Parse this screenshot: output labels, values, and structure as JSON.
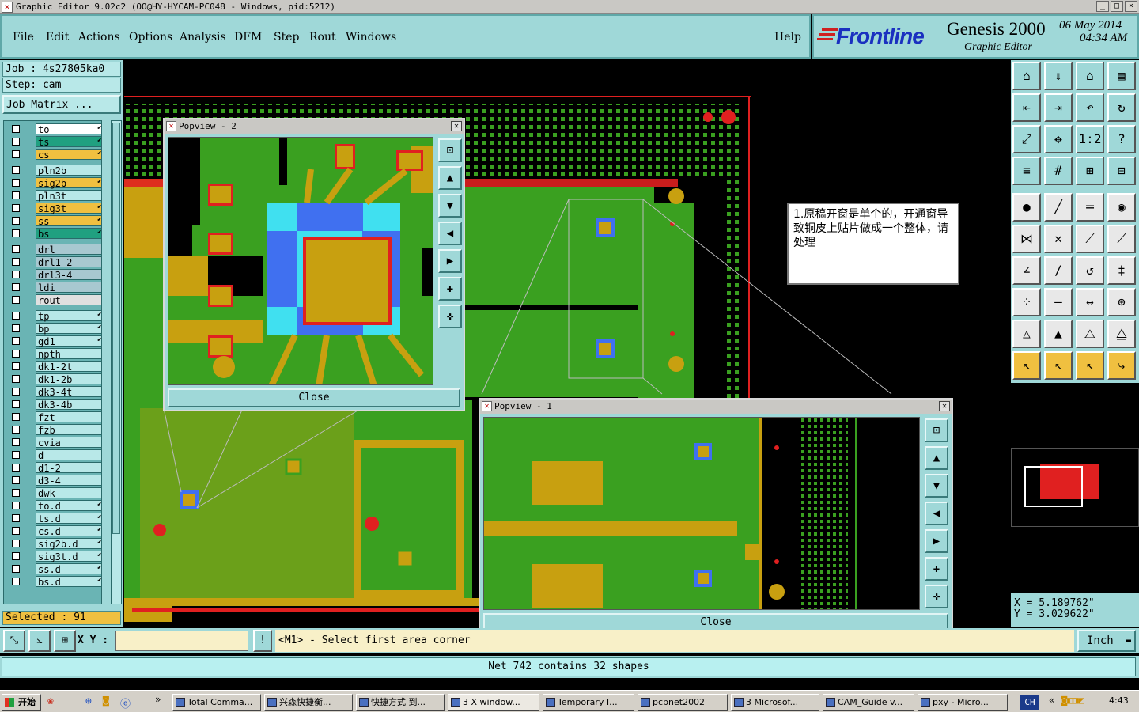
{
  "window": {
    "title": "Graphic Editor 9.02c2 (OO@HY-HYCAM-PC048 - Windows, pid:5212)",
    "controls": [
      "_",
      "□",
      "×"
    ]
  },
  "menu": [
    "File",
    "Edit",
    "Actions",
    "Options",
    "Analysis",
    "DFM",
    "Step",
    "Rout",
    "Windows"
  ],
  "help_label": "Help",
  "brand": {
    "logo": "Frontline",
    "product": "Genesis 2000",
    "subtitle": "Graphic Editor",
    "date": "06 May 2014",
    "time": "04:34 AM"
  },
  "job": {
    "job_label": "Job : 4s27805ka0",
    "step_label": "Step: cam",
    "matrix_button": "Job Matrix ..."
  },
  "layers": [
    {
      "name": "to",
      "color": "#ffffff",
      "mark": "⬋"
    },
    {
      "name": "ts",
      "color": "#20a080",
      "mark": "⬋"
    },
    {
      "name": "cs",
      "color": "#f0c040",
      "mark": "⬋"
    },
    {
      "name": "pln2b",
      "color": "#b8e8e8",
      "mark": ""
    },
    {
      "name": "sig2b",
      "color": "#f0c040",
      "mark": "⬋"
    },
    {
      "name": "pln3t",
      "color": "#b8e8e8",
      "mark": ""
    },
    {
      "name": "sig3t",
      "color": "#f0c040",
      "mark": "⬋"
    },
    {
      "name": "ss",
      "color": "#f0c040",
      "mark": "⬋"
    },
    {
      "name": "bs",
      "color": "#20a080",
      "mark": "⬋"
    },
    {
      "name": "drl",
      "color": "#a8c8d0",
      "mark": ""
    },
    {
      "name": "drl1-2",
      "color": "#a8c8d0",
      "mark": ""
    },
    {
      "name": "drl3-4",
      "color": "#a8c8d0",
      "mark": ""
    },
    {
      "name": "ldi",
      "color": "#a8c8d0",
      "mark": ""
    },
    {
      "name": "rout",
      "color": "#e0e0e0",
      "mark": ""
    },
    {
      "name": "tp",
      "color": "#b8e8e8",
      "mark": "⬋"
    },
    {
      "name": "bp",
      "color": "#b8e8e8",
      "mark": "⬋"
    },
    {
      "name": "gd1",
      "color": "#b8e8e8",
      "mark": "⬋"
    },
    {
      "name": "npth",
      "color": "#b8e8e8",
      "mark": ""
    },
    {
      "name": "dk1-2t",
      "color": "#b8e8e8",
      "mark": ""
    },
    {
      "name": "dk1-2b",
      "color": "#b8e8e8",
      "mark": ""
    },
    {
      "name": "dk3-4t",
      "color": "#b8e8e8",
      "mark": ""
    },
    {
      "name": "dk3-4b",
      "color": "#b8e8e8",
      "mark": ""
    },
    {
      "name": "fzt",
      "color": "#b8e8e8",
      "mark": ""
    },
    {
      "name": "fzb",
      "color": "#b8e8e8",
      "mark": ""
    },
    {
      "name": "cvia",
      "color": "#b8e8e8",
      "mark": ""
    },
    {
      "name": "d",
      "color": "#b8e8e8",
      "mark": ""
    },
    {
      "name": "d1-2",
      "color": "#b8e8e8",
      "mark": ""
    },
    {
      "name": "d3-4",
      "color": "#b8e8e8",
      "mark": ""
    },
    {
      "name": "dwk",
      "color": "#b8e8e8",
      "mark": ""
    },
    {
      "name": "to.d",
      "color": "#b8e8e8",
      "mark": "⬋"
    },
    {
      "name": "ts.d",
      "color": "#b8e8e8",
      "mark": "⬋"
    },
    {
      "name": "cs.d",
      "color": "#b8e8e8",
      "mark": "⬋"
    },
    {
      "name": "sig2b.d",
      "color": "#b8e8e8",
      "mark": "⬋"
    },
    {
      "name": "sig3t.d",
      "color": "#b8e8e8",
      "mark": "⬋"
    },
    {
      "name": "ss.d",
      "color": "#b8e8e8",
      "mark": "⬋"
    },
    {
      "name": "bs.d",
      "color": "#b8e8e8",
      "mark": "⬋"
    }
  ],
  "selected_label": "Selected : 91",
  "popup2": {
    "title": "Popview - 2",
    "close_label": "Close"
  },
  "popup1": {
    "title": "Popview - 1",
    "close_label": "Close"
  },
  "annotation": "1.原稿开窗是单个的，开通窗导致铜皮上贴片做成一个整体，请处理",
  "coords": {
    "x": "X  =  5.189762\"",
    "y": "Y  =  3.029622\""
  },
  "cmd": {
    "xy_label": "X Y :",
    "input_value": "",
    "prompt": "<M1> - Select first area corner",
    "units": "Inch"
  },
  "status": "Net 742 contains 32 shapes",
  "taskbar": {
    "start": "开始",
    "tasks": [
      "Total Comma...",
      "兴森快捷衡...",
      "快捷方式 到...",
      "3 X window...",
      "Temporary I...",
      "pcbnet2002",
      "3 Microsof...",
      "CAM_Guide v...",
      "pxy - Micro..."
    ],
    "lang": "CH",
    "clock": "4:43"
  },
  "colors": {
    "teal": "#9fd8d8",
    "pcb_green": "#3aa020",
    "pcb_copper": "#c8a010",
    "pad_blue": "#4070f0",
    "mask_red": "#e02020"
  }
}
